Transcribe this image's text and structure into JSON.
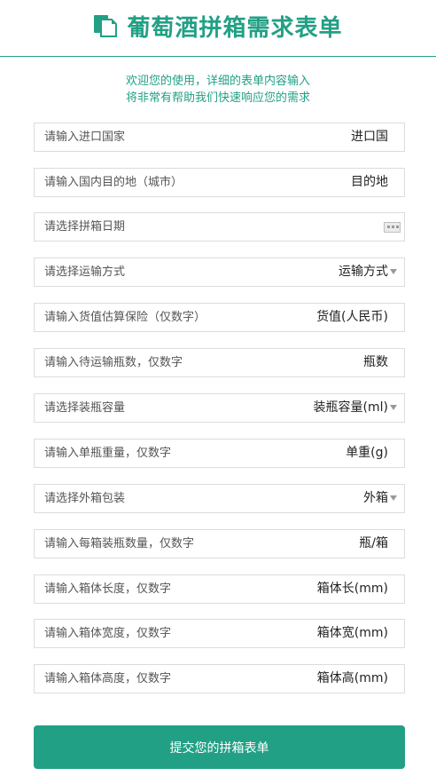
{
  "header": {
    "title": "葡萄酒拼箱需求表单",
    "icon": "document-icon",
    "accent": "#22a085"
  },
  "intro": {
    "line1": "欢迎您的使用，详细的表单内容输入",
    "line2": "将非常有帮助我们快速响应您的需求"
  },
  "fields": [
    {
      "placeholder": "请输入进口国家",
      "unit": "进口国"
    },
    {
      "placeholder": "请输入国内目的地（城市）",
      "unit": "目的地"
    },
    {
      "placeholder": "请选择拼箱日期",
      "unit": ""
    },
    {
      "placeholder": "请选择运输方式",
      "unit": "运输方式"
    },
    {
      "placeholder": "请输入货值估算保险（仅数字）",
      "unit": "货值(人民币)"
    },
    {
      "placeholder": "请输入待运输瓶数，仅数字",
      "unit": "瓶数"
    },
    {
      "placeholder": "请选择装瓶容量",
      "unit": "装瓶容量(ml)"
    },
    {
      "placeholder": "请输入单瓶重量，仅数字",
      "unit": "单重(g)"
    },
    {
      "placeholder": "请选择外箱包装",
      "unit": "外箱"
    },
    {
      "placeholder": "请输入每箱装瓶数量，仅数字",
      "unit": "瓶/箱"
    },
    {
      "placeholder": "请输入箱体长度，仅数字",
      "unit": "箱体长(mm)"
    },
    {
      "placeholder": "请输入箱体宽度，仅数字",
      "unit": "箱体宽(mm)"
    },
    {
      "placeholder": "请输入箱体高度，仅数字",
      "unit": "箱体高(mm)"
    }
  ],
  "submit": {
    "label": "提交您的拼箱表单"
  }
}
